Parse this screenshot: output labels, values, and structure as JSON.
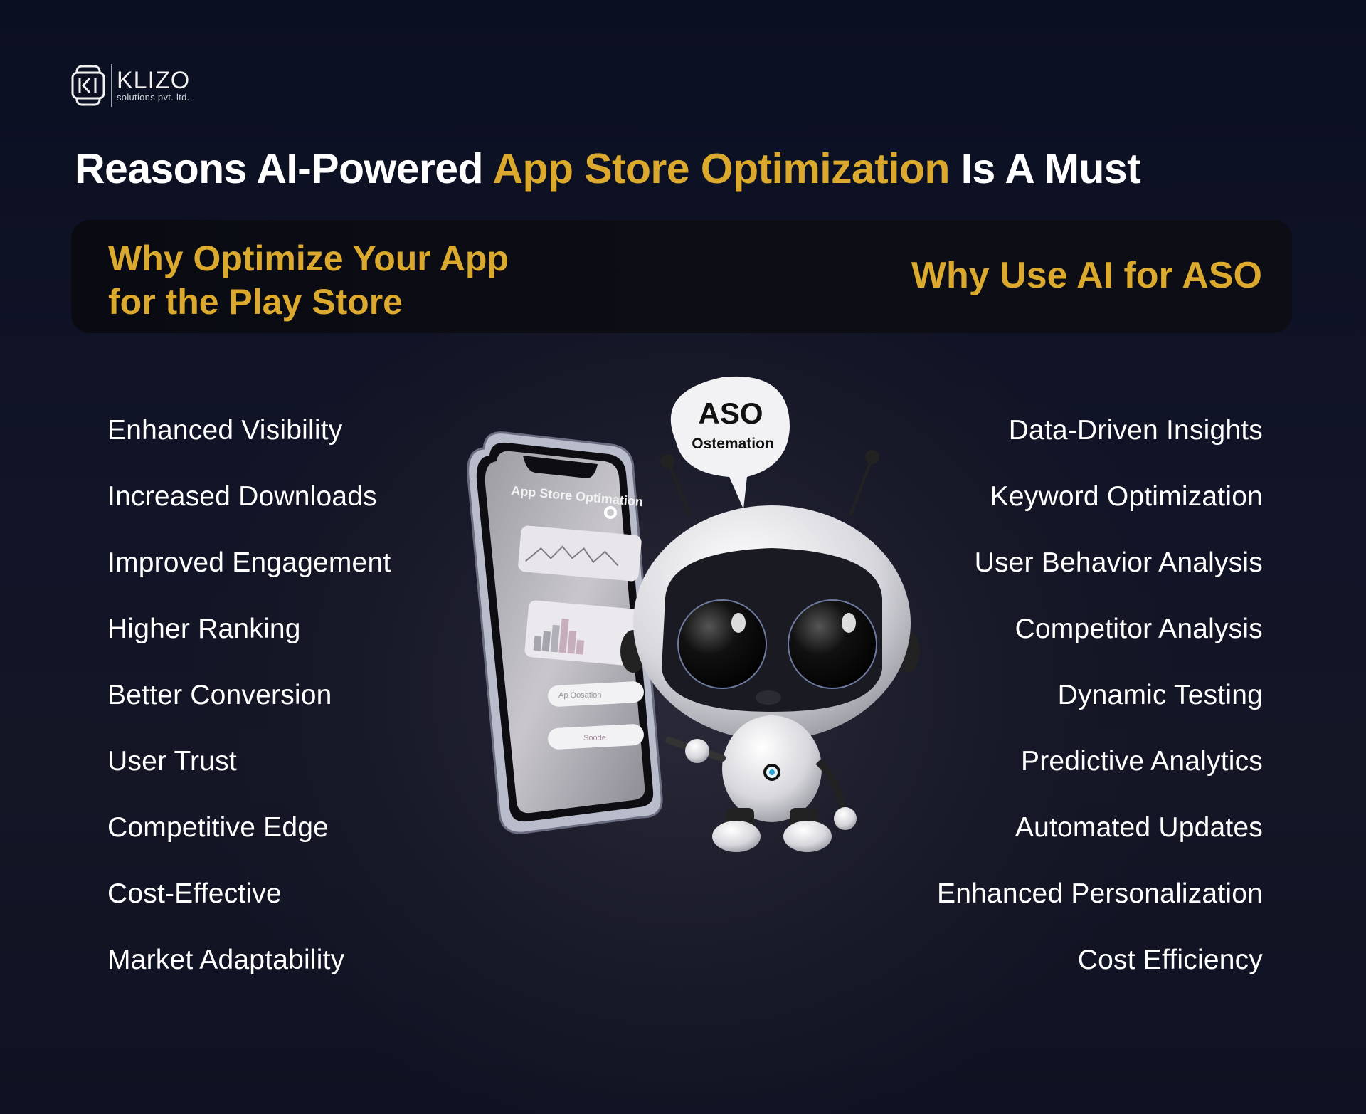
{
  "brand": {
    "name": "KLIZO",
    "tagline": "solutions pvt. ltd.",
    "logo_icon": "klizo-k-monitor-icon"
  },
  "colors": {
    "accent": "#dba92e",
    "background": "#111427",
    "panel": "#0b0c14",
    "text": "#ffffff"
  },
  "title": {
    "prefix": "Reasons AI-Powered ",
    "highlight": "App Store Optimization",
    "suffix": " Is A Must"
  },
  "panel": {
    "left_heading_line1": "Why Optimize Your App",
    "left_heading_line2": "for the Play Store",
    "right_heading": "Why Use AI for ASO"
  },
  "left_list": [
    "Enhanced Visibility",
    "Increased Downloads",
    "Improved Engagement",
    "Higher Ranking",
    "Better Conversion",
    "User Trust",
    "Competitive Edge",
    "Cost-Effective",
    "Market Adaptability"
  ],
  "right_list": [
    "Data-Driven Insights",
    "Keyword Optimization",
    "User Behavior Analysis",
    "Competitor Analysis",
    "Dynamic Testing",
    "Predictive Analytics",
    "Automated Updates",
    "Enhanced Personalization",
    "Cost Efficiency"
  ],
  "illustration": {
    "bubble_title": "ASO",
    "bubble_subtitle": "Ostemation",
    "phone_screen_title": "App Store Optimation",
    "phone_input_1": "Ap Oosation",
    "phone_button": "Soode"
  }
}
